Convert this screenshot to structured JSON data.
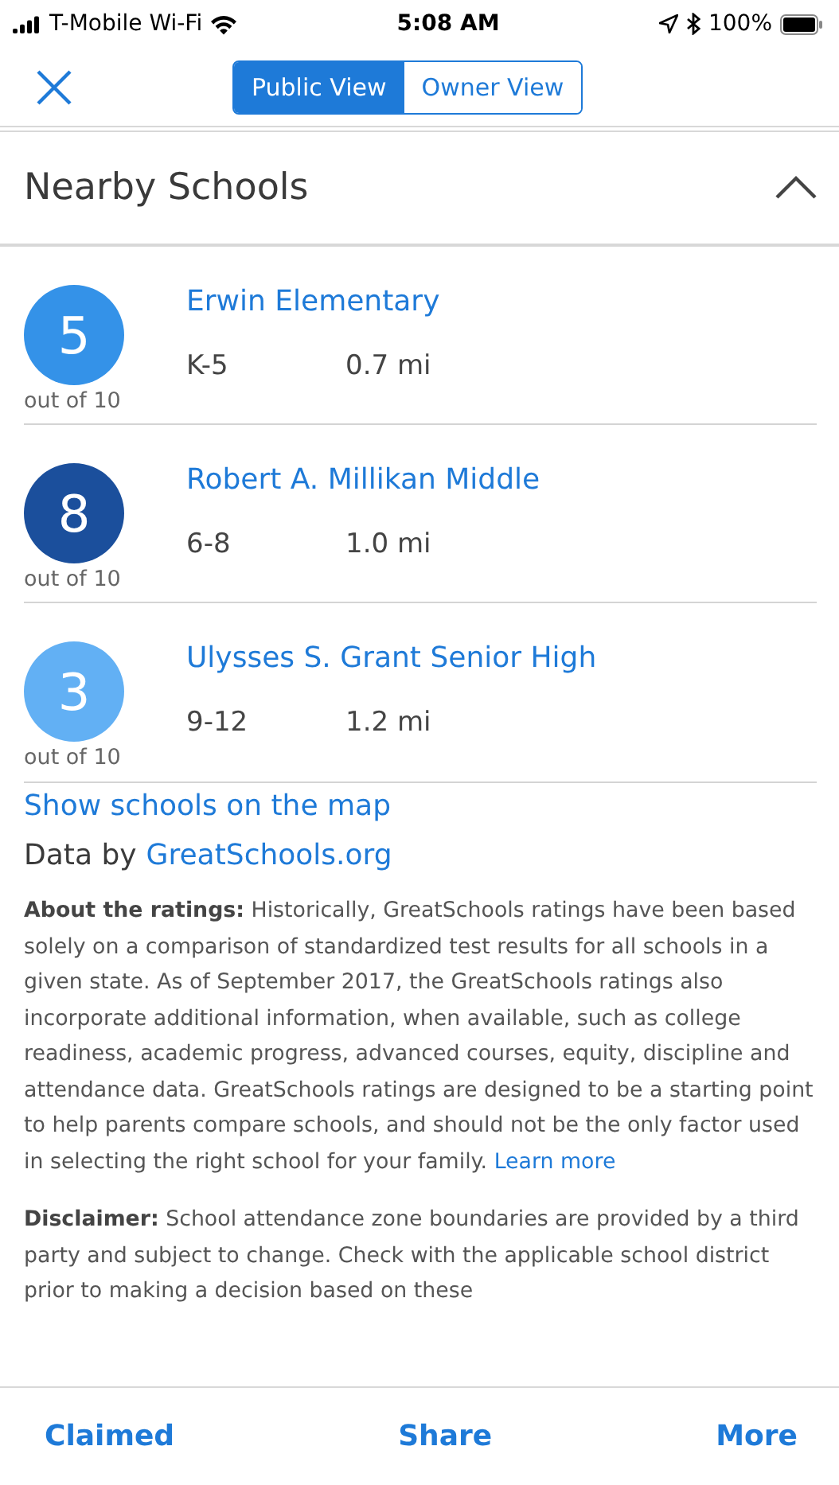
{
  "status_bar": {
    "carrier": "T-Mobile Wi-Fi",
    "time": "5:08 AM",
    "battery": "100%"
  },
  "header": {
    "segments": [
      {
        "label": "Public View",
        "selected": true
      },
      {
        "label": "Owner View",
        "selected": false
      }
    ]
  },
  "section": {
    "title": "Nearby Schools",
    "expanded": true
  },
  "schools": [
    {
      "rating": "5",
      "out_of": "out of 10",
      "color": "#3492e8",
      "name": "Erwin Elementary",
      "grades": "K-5",
      "distance": "0.7 mi"
    },
    {
      "rating": "8",
      "out_of": "out of 10",
      "color": "#1b4f9c",
      "name": "Robert A. Millikan Middle",
      "grades": "6-8",
      "distance": "1.0 mi"
    },
    {
      "rating": "3",
      "out_of": "out of 10",
      "color": "#62b0f4",
      "name": "Ulysses S. Grant Senior High",
      "grades": "9-12",
      "distance": "1.2 mi"
    }
  ],
  "map_link": "Show schools on the map",
  "data_by": {
    "label": "Data by",
    "link": "GreatSchools.org"
  },
  "about": {
    "text": "**About the ratings:** Historically, GreatSchools ratings have been based solely on a comparison of standardized test results for all schools in a given state. As of September 2017, the GreatSchools ratings also incorporate additional information, when available, such as college readiness, academic progress, advanced courses, equity, discipline and attendance data. GreatSchools ratings are designed to be a starting point to help parents compare schools, and should not be the only factor used in selecting the right school for your family.",
    "link": "Learn more"
  },
  "disclaimer": "**Disclaimer:** School attendance zone boundaries are provided by a third party and subject to change. Check with the applicable school district prior to making a decision based on these",
  "bottom_bar": [
    "Claimed",
    "Share",
    "More"
  ]
}
